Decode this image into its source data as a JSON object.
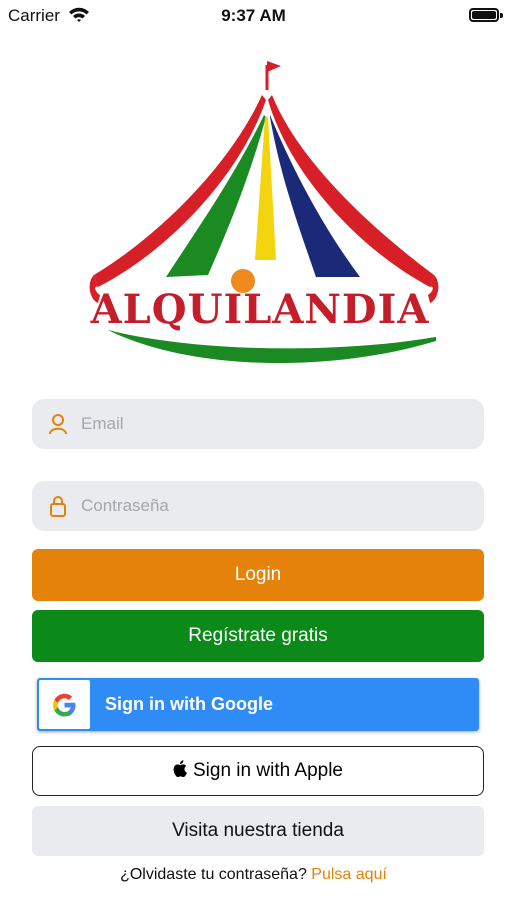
{
  "status_bar": {
    "carrier": "Carrier",
    "time": "9:37 AM",
    "icons": [
      "wifi-icon",
      "battery-icon"
    ]
  },
  "logo": {
    "text": "ALQUILANDIA",
    "colors": {
      "red": "#d61f26",
      "green": "#1c8a22",
      "yellow": "#f2d40f",
      "navy": "#1a2a78",
      "orange": "#f08a1c"
    }
  },
  "form": {
    "email": {
      "placeholder": "Email",
      "value": "",
      "icon": "user-icon"
    },
    "password": {
      "placeholder": "Contraseña",
      "value": "",
      "icon": "lock-icon"
    }
  },
  "buttons": {
    "login": "Login",
    "register": "Regístrate gratis",
    "google": "Sign in with Google",
    "apple": "Sign in with Apple",
    "store": "Visita nuestra tienda"
  },
  "forgot": {
    "question": "¿Olvidaste tu contraseña?",
    "link": "Pulsa aquí"
  },
  "colors": {
    "accent_orange": "#e5820a",
    "accent_green": "#0b8a1a",
    "google_blue": "#2f8cf7",
    "field_bg": "#e9ebee"
  }
}
